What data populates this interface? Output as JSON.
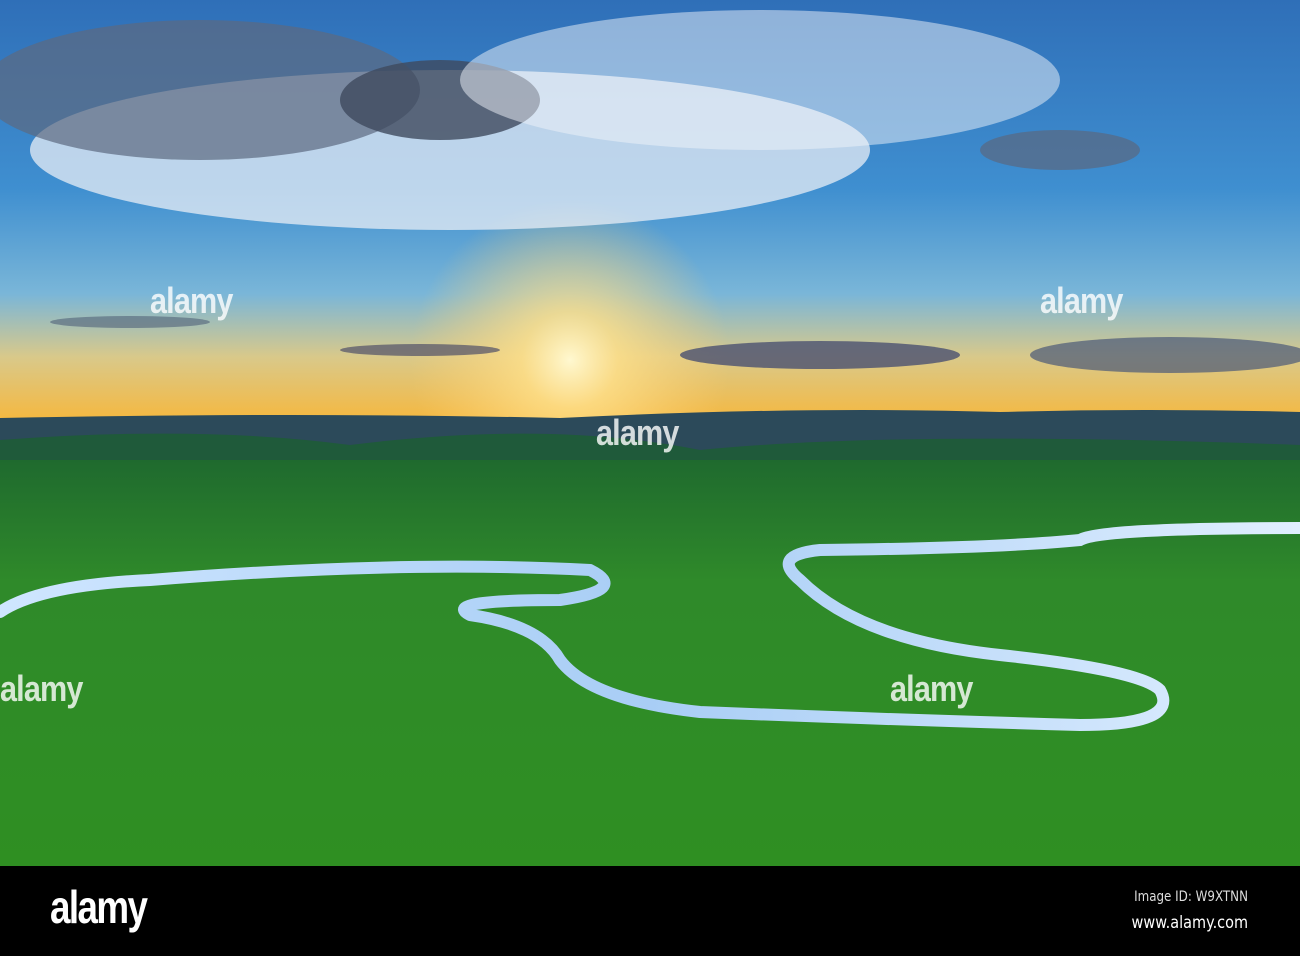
{
  "photo": {
    "subject": "sunset over grassland with meandering river"
  },
  "watermark": {
    "text": "alamy"
  },
  "footer": {
    "logo": "alamy",
    "image_id": "Image ID: W9XTNN",
    "url": "www.alamy.com"
  }
}
